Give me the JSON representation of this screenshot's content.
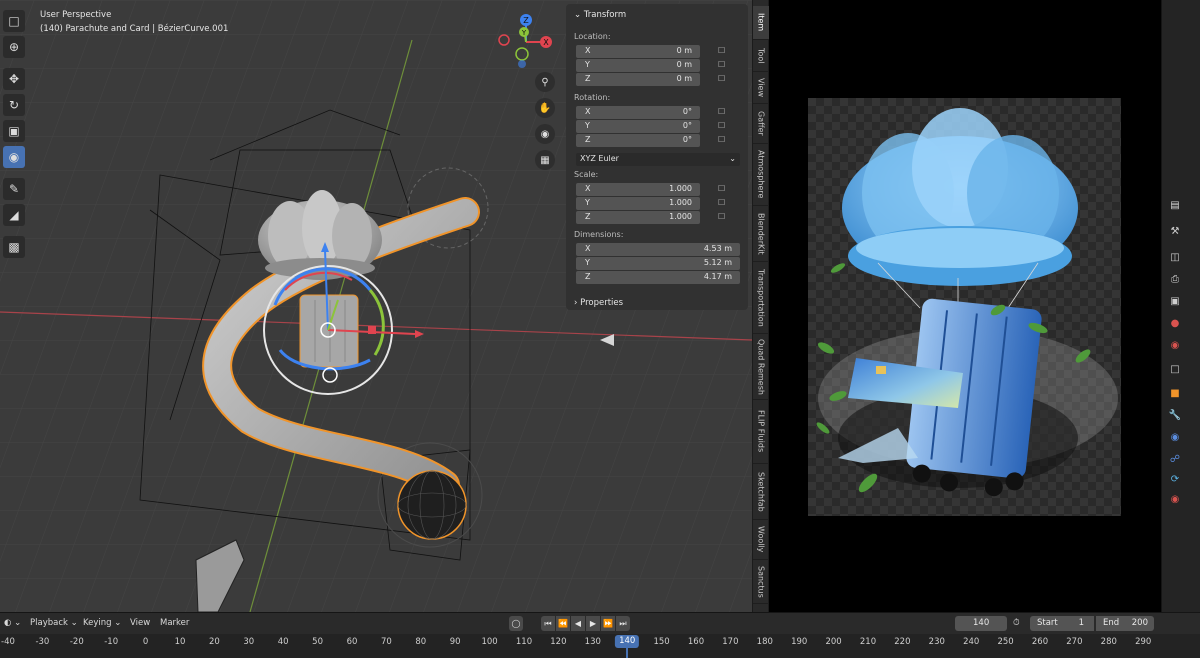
{
  "viewport": {
    "title": "User Perspective",
    "object": "(140) Parachute and Card | BézierCurve.001",
    "gizmo_axes": [
      "Z",
      "Y",
      "X"
    ],
    "toolbar_icons": [
      "select-box-icon",
      "cursor-icon",
      "move-icon",
      "rotate-icon",
      "scale-icon",
      "transform-icon",
      "annotate-icon",
      "measure-icon",
      "add-cube-icon"
    ],
    "nav_icons": [
      "zoom-icon",
      "hand-icon",
      "camera-icon",
      "grid-icon"
    ]
  },
  "npanel": {
    "header": "Transform",
    "location_label": "Location:",
    "location": [
      {
        "axis": "X",
        "value": "0 m"
      },
      {
        "axis": "Y",
        "value": "0 m"
      },
      {
        "axis": "Z",
        "value": "0 m"
      }
    ],
    "rotation_label": "Rotation:",
    "rotation": [
      {
        "axis": "X",
        "value": "0°"
      },
      {
        "axis": "Y",
        "value": "0°"
      },
      {
        "axis": "Z",
        "value": "0°"
      }
    ],
    "rotation_mode": "XYZ Euler",
    "scale_label": "Scale:",
    "scale": [
      {
        "axis": "X",
        "value": "1.000"
      },
      {
        "axis": "Y",
        "value": "1.000"
      },
      {
        "axis": "Z",
        "value": "1.000"
      }
    ],
    "dimensions_label": "Dimensions:",
    "dimensions": [
      {
        "axis": "X",
        "value": "4.53 m"
      },
      {
        "axis": "Y",
        "value": "5.12 m"
      },
      {
        "axis": "Z",
        "value": "4.17 m"
      }
    ],
    "properties_label": "Properties"
  },
  "side_tabs": [
    "Item",
    "Tool",
    "View",
    "Gaffer",
    "Atmosphere",
    "BlenderKit",
    "Transportation",
    "Quad Remesh",
    "FLIP Fluids",
    "Sketchfab",
    "Woolly",
    "Sanctus"
  ],
  "timeline": {
    "menus": [
      "Playback",
      "Keying",
      "View",
      "Marker"
    ],
    "current_frame": "140",
    "start_label": "Start",
    "start_value": "1",
    "end_label": "End",
    "end_value": "200",
    "ruler_ticks": [
      "-40",
      "-30",
      "-20",
      "-10",
      "0",
      "10",
      "20",
      "30",
      "40",
      "50",
      "60",
      "70",
      "80",
      "90",
      "100",
      "110",
      "120",
      "130",
      "140",
      "150",
      "160",
      "170",
      "180",
      "190",
      "200",
      "210",
      "220",
      "230",
      "240",
      "250",
      "260",
      "270",
      "280",
      "290"
    ]
  },
  "colors": {
    "accent": "#4772b3",
    "x_axis": "#e0444f",
    "y_axis": "#8cc43a",
    "z_axis": "#3d82f0",
    "selection": "#f0942a"
  }
}
